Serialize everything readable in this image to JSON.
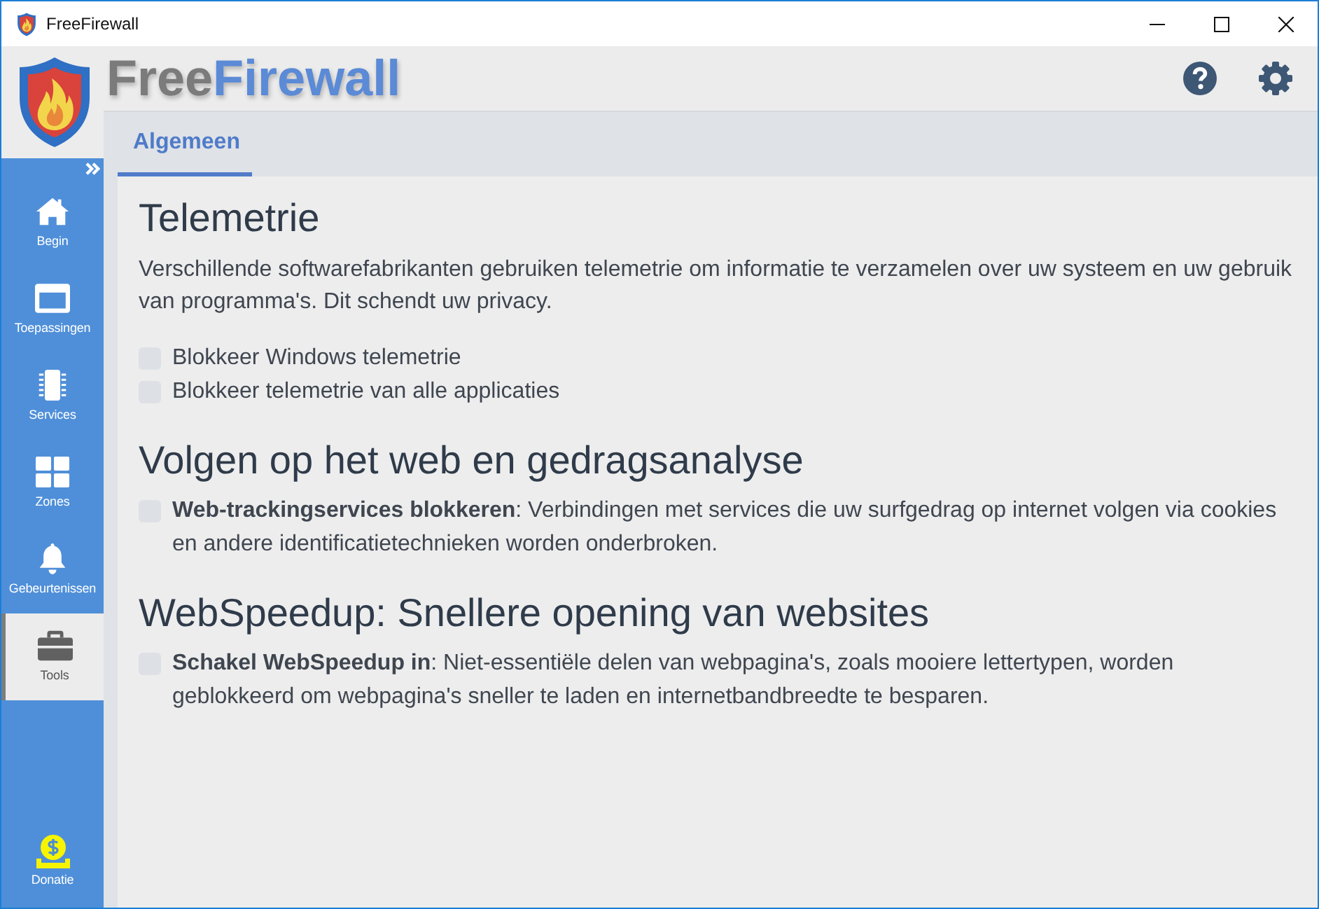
{
  "window": {
    "title": "FreeFirewall"
  },
  "header": {
    "logo_words": [
      "Free",
      "Firewall"
    ]
  },
  "sidebar": {
    "items": [
      {
        "label": "Begin",
        "selected": false
      },
      {
        "label": "Toepassingen",
        "selected": false
      },
      {
        "label": "Services",
        "selected": false
      },
      {
        "label": "Zones",
        "selected": false
      },
      {
        "label": "Gebeurtenissen",
        "selected": false
      },
      {
        "label": "Tools",
        "selected": true
      }
    ],
    "footer_item": {
      "label": "Donatie"
    }
  },
  "tabs": [
    {
      "label": "Algemeen",
      "selected": true
    }
  ],
  "sections": [
    {
      "title": "Telemetrie",
      "description": "Verschillende softwarefabrikanten gebruiken telemetrie om informatie te verzamelen over uw systeem en uw gebruik van programma's. Dit schendt uw privacy.",
      "options": [
        {
          "label": "Blokkeer Windows telemetrie",
          "checked": false
        },
        {
          "label": "Blokkeer telemetrie van alle applicaties",
          "checked": false
        }
      ]
    },
    {
      "title": "Volgen op het web en gedragsanalyse",
      "options": [
        {
          "label": "**Web-trackingservices blokkeren**: Verbindingen met services die uw surfgedrag op internet volgen via cookies en andere identificatietechnieken worden onderbroken.",
          "checked": false
        }
      ]
    },
    {
      "title": "WebSpeedup: Snellere opening van websites",
      "options": [
        {
          "label": "**Schakel WebSpeedup in**: Niet-essentiële delen van webpagina's, zoals mooiere lettertypen, worden geblokkeerd om webpagina's sneller te laden en internetbandbreedte te besparen.",
          "checked": false
        }
      ]
    }
  ]
}
